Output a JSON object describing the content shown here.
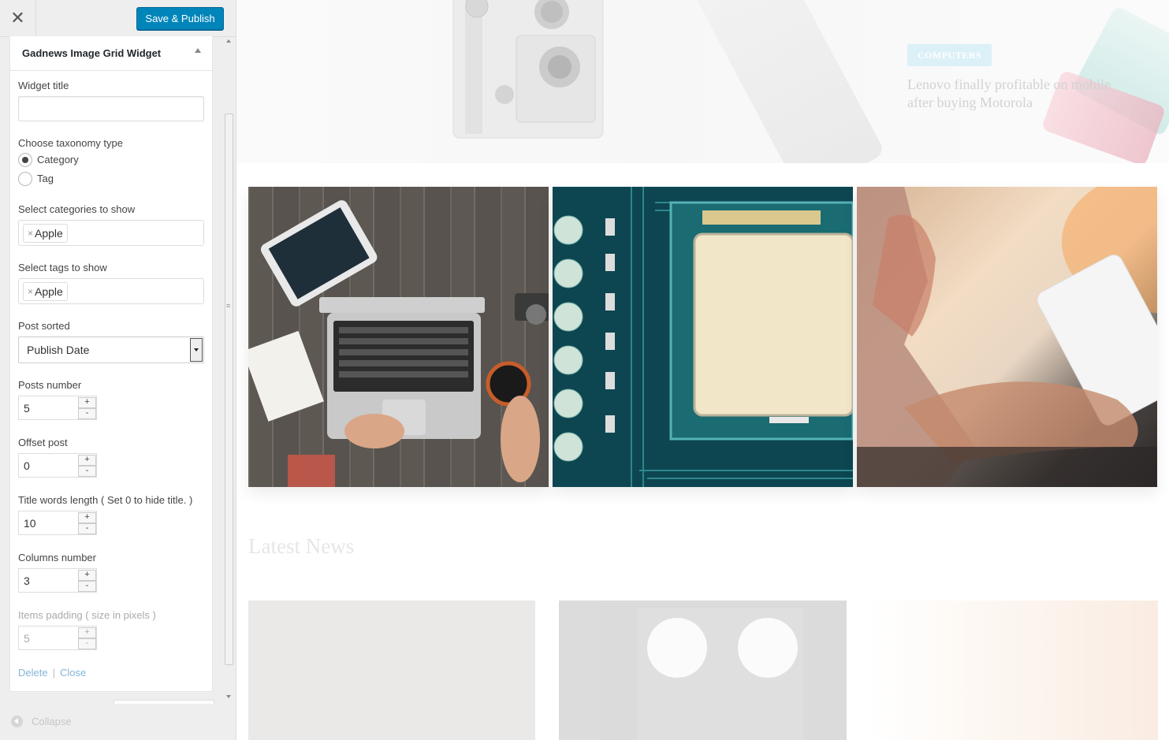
{
  "toolbar": {
    "close_icon": "close-icon",
    "publish_label": "Save & Publish"
  },
  "widget": {
    "title": "Gadnews Image Grid Widget",
    "fields": {
      "widget_title_label": "Widget title",
      "widget_title_value": "",
      "taxonomy_label": "Choose taxonomy type",
      "taxonomy_options": [
        "Category",
        "Tag"
      ],
      "taxonomy_selected": "Category",
      "categories_label": "Select categories to show",
      "categories_tags": [
        "Apple"
      ],
      "tags_label": "Select tags to show",
      "tags_tags": [
        "Apple"
      ],
      "post_sorted_label": "Post sorted",
      "post_sorted_value": "Publish Date",
      "posts_number_label": "Posts number",
      "posts_number_value": "5",
      "offset_label": "Offset post",
      "offset_value": "0",
      "title_words_label": "Title words length ( Set 0 to hide title. )",
      "title_words_value": "10",
      "columns_label": "Columns number",
      "columns_value": "3",
      "padding_label": "Items padding ( size in pixels )",
      "padding_value": "5"
    },
    "links": {
      "delete": "Delete",
      "separator": "|",
      "close": "Close"
    }
  },
  "spin": {
    "plus": "+",
    "minus": "-",
    "tag_remove": "×"
  },
  "footer": {
    "collapse_label": "Collapse"
  },
  "preview": {
    "hero_badge": "COMPUTERS",
    "hero_title": "Lenovo finally profitable on mobile after buying Motorola",
    "latest_news_heading": "Latest News"
  },
  "colors": {
    "primary_button": "#0085ba",
    "link": "#82b5d6",
    "sidebar_bg": "#eeeeee"
  }
}
